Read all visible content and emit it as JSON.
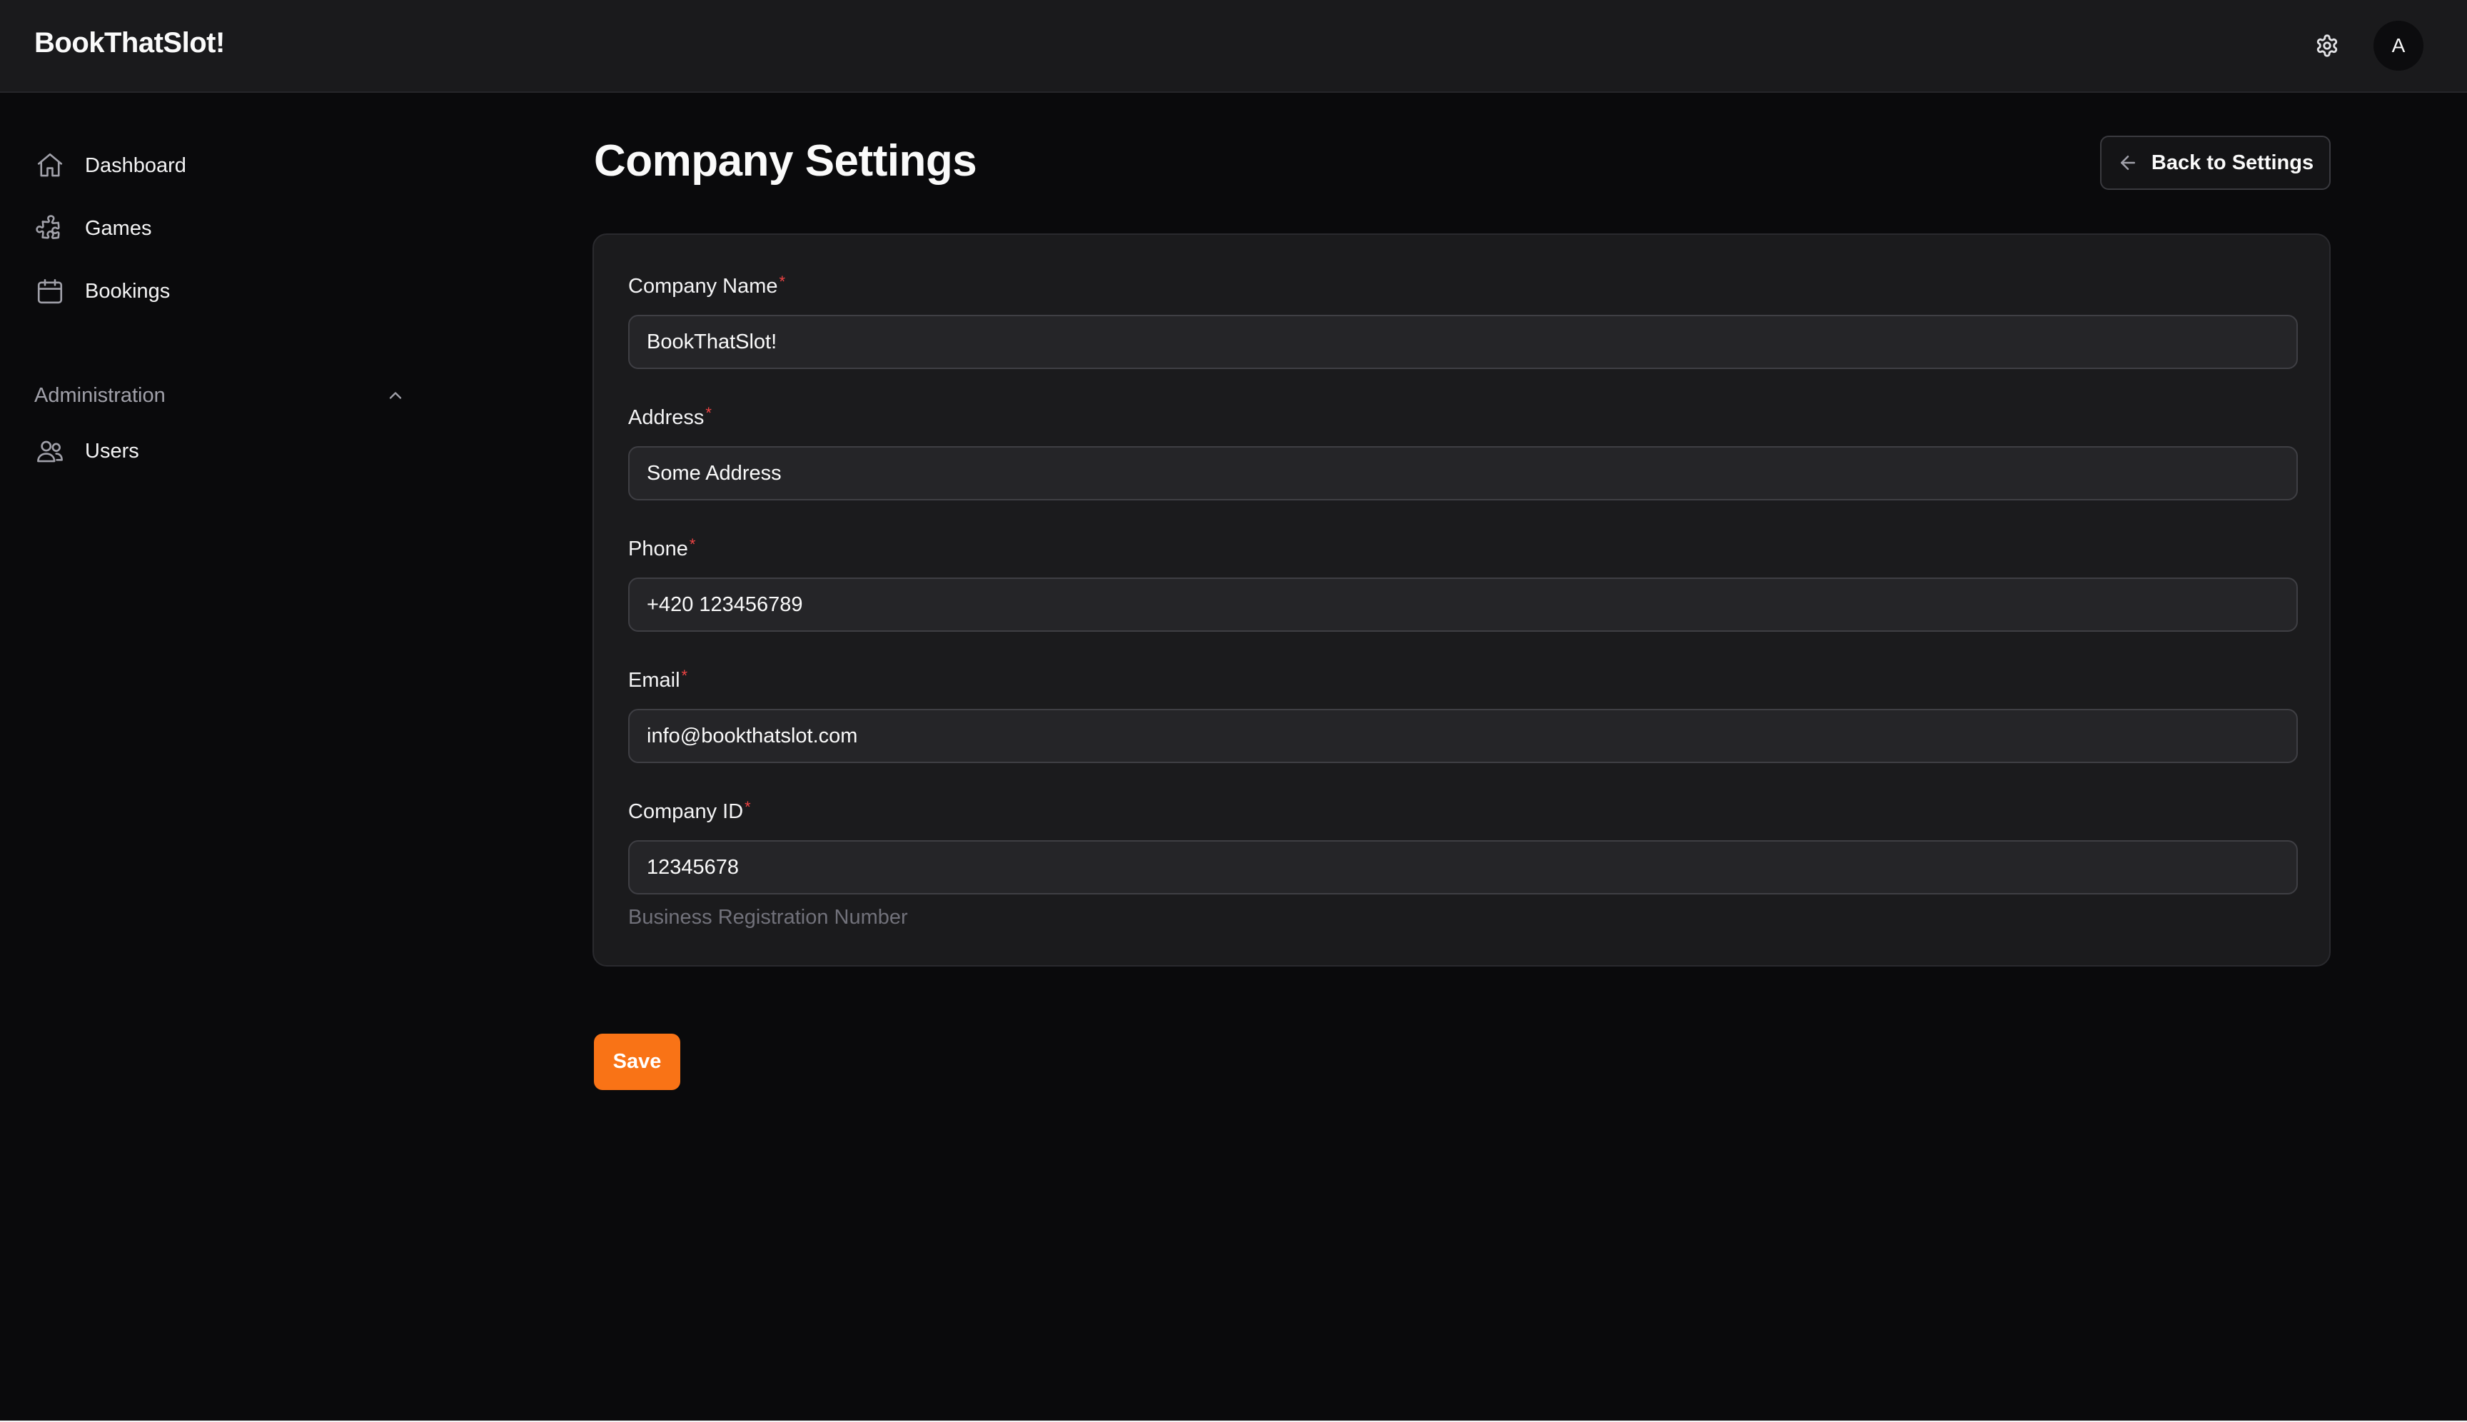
{
  "app": {
    "name": "BookThatSlot!",
    "avatar_initial": "A",
    "accent_color": "#f97316"
  },
  "header": {
    "settings_icon": "gear-icon"
  },
  "sidebar": {
    "items": [
      {
        "label": "Dashboard",
        "icon": "home-icon"
      },
      {
        "label": "Games",
        "icon": "puzzle-icon"
      },
      {
        "label": "Bookings",
        "icon": "calendar-icon"
      }
    ],
    "sections": [
      {
        "label": "Administration",
        "expanded": true,
        "items": [
          {
            "label": "Users",
            "icon": "users-icon"
          }
        ]
      }
    ]
  },
  "page": {
    "title": "Company Settings",
    "back_button_label": "Back to Settings"
  },
  "form": {
    "fields": [
      {
        "label": "Company Name",
        "required": "*",
        "value": "BookThatSlot!"
      },
      {
        "label": "Address",
        "required": "*",
        "value": "Some Address"
      },
      {
        "label": "Phone",
        "required": "*",
        "value": "+420 123456789"
      },
      {
        "label": "Email",
        "required": "*",
        "value": "info@bookthatslot.com"
      },
      {
        "label": "Company ID",
        "required": "*",
        "value": "12345678",
        "hint": "Business Registration Number"
      }
    ],
    "save_label": "Save"
  }
}
